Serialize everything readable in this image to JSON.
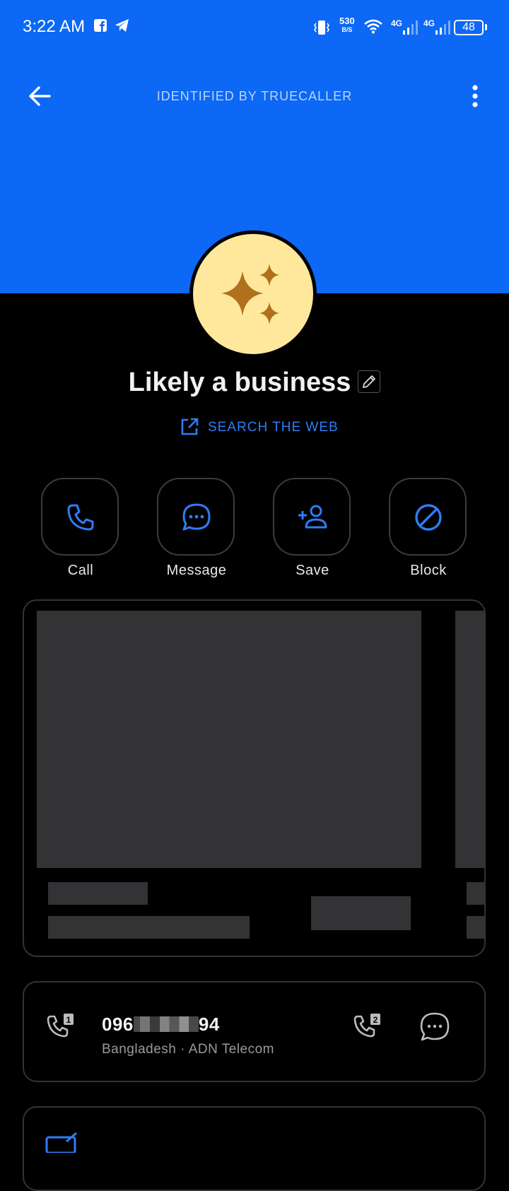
{
  "status_bar": {
    "time": "3:22 AM",
    "net_speed_value": "530",
    "net_speed_unit": "B/S",
    "signal1": "4G",
    "signal2": "4G",
    "battery": "48",
    "icons": [
      "facebook-icon",
      "telegram-icon",
      "vibrate-icon",
      "wifi-icon",
      "signal-icon",
      "battery-icon"
    ]
  },
  "toolbar": {
    "title": "IDENTIFIED BY TRUECALLER"
  },
  "profile": {
    "name": "Likely a business",
    "search_web_label": "SEARCH THE WEB"
  },
  "actions": [
    {
      "label": "Call",
      "icon": "phone-icon"
    },
    {
      "label": "Message",
      "icon": "chat-icon"
    },
    {
      "label": "Save",
      "icon": "add-person-icon"
    },
    {
      "label": "Block",
      "icon": "block-icon"
    }
  ],
  "phone": {
    "number_prefix": "096",
    "number_suffix": "94",
    "details": "Bangladesh · ADN Telecom"
  },
  "colors": {
    "header_blue": "#0c68f5",
    "accent_blue": "#2f7cf6",
    "avatar_bg": "#ffe89c",
    "avatar_star": "#b0701c",
    "background": "#000000"
  }
}
